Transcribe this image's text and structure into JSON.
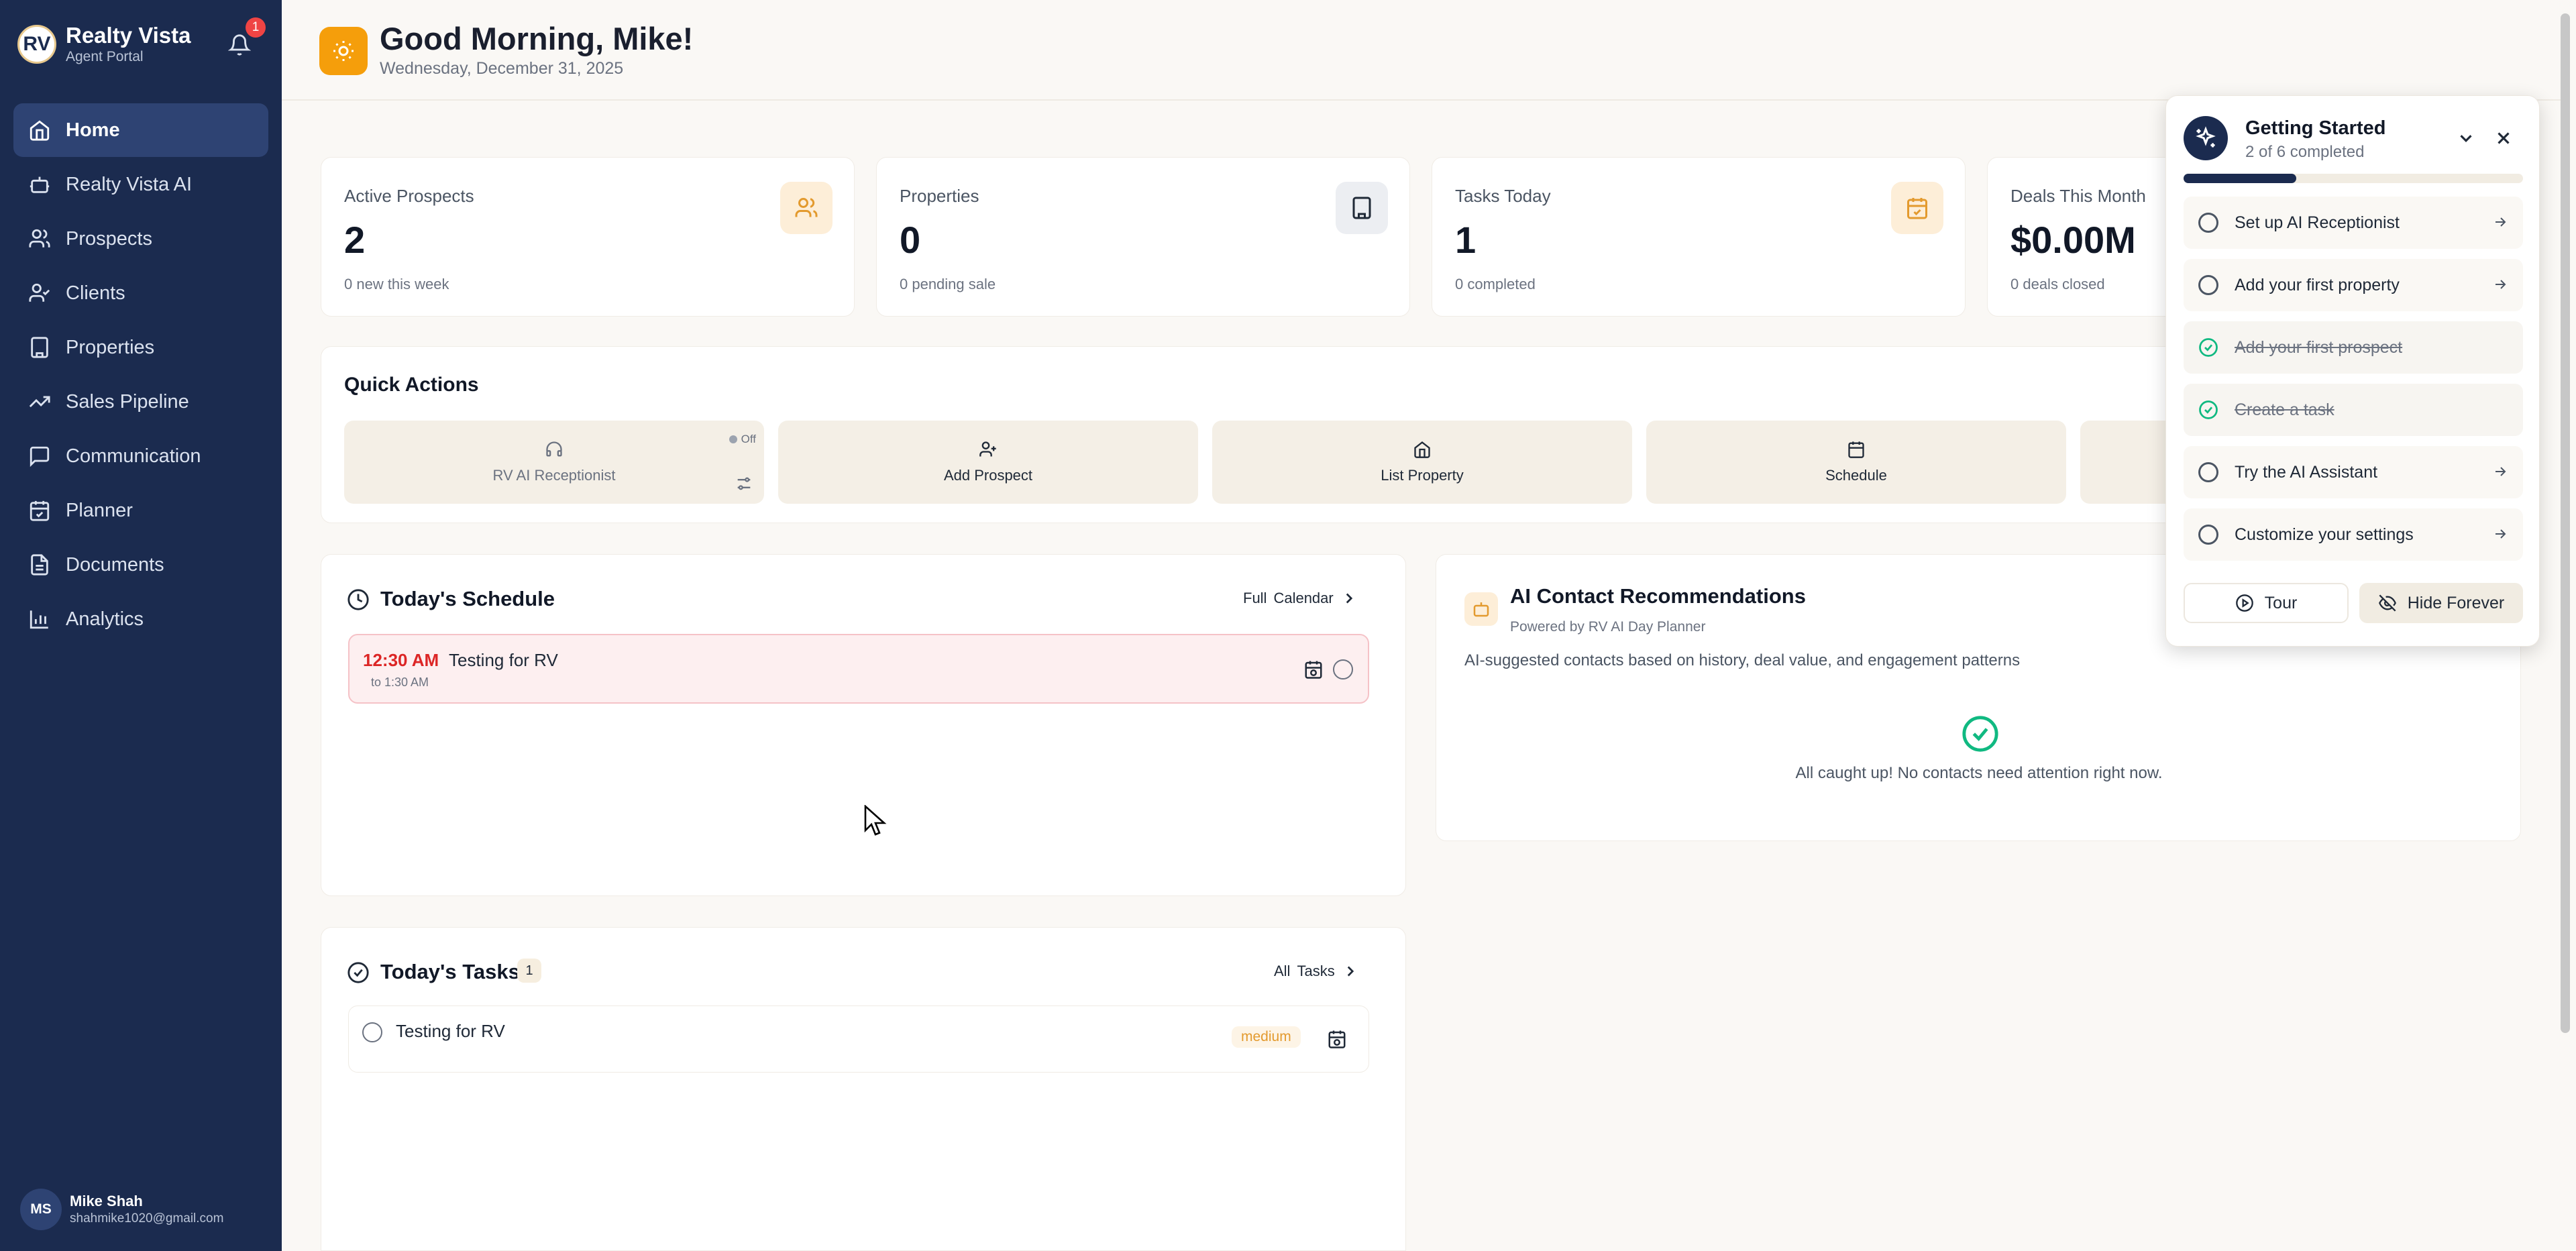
{
  "app": {
    "name": "Realty Vista",
    "subtitle": "Agent Portal",
    "logo_text": "RV",
    "notification_count": "1"
  },
  "nav": [
    {
      "label": "Home",
      "icon": "home-icon"
    },
    {
      "label": "Realty Vista AI",
      "icon": "bot-icon"
    },
    {
      "label": "Prospects",
      "icon": "users-icon"
    },
    {
      "label": "Clients",
      "icon": "user-check-icon"
    },
    {
      "label": "Properties",
      "icon": "building-icon"
    },
    {
      "label": "Sales Pipeline",
      "icon": "trending-up-icon"
    },
    {
      "label": "Communication",
      "icon": "message-icon"
    },
    {
      "label": "Planner",
      "icon": "calendar-check-icon"
    },
    {
      "label": "Documents",
      "icon": "file-icon"
    },
    {
      "label": "Analytics",
      "icon": "bar-chart-icon"
    }
  ],
  "user": {
    "initials": "MS",
    "name": "Mike Shah",
    "email": "shahmike1020@gmail.com"
  },
  "header": {
    "greeting": "Good Morning, Mike!",
    "date": "Wednesday, December 31, 2025"
  },
  "stats": [
    {
      "label": "Active Prospects",
      "value": "2",
      "sub": "0 new this week",
      "icon": "users-icon"
    },
    {
      "label": "Properties",
      "value": "0",
      "sub": "0 pending sale",
      "icon": "building-icon"
    },
    {
      "label": "Tasks Today",
      "value": "1",
      "sub": "0 completed",
      "icon": "calendar-check-icon"
    },
    {
      "label": "Deals This Month",
      "value": "$0.00M",
      "sub": "0 deals closed",
      "icon": "dollar-icon"
    }
  ],
  "quick_actions": {
    "title": "Quick Actions",
    "receptionist": {
      "label": "RV AI Receptionist",
      "status": "Off"
    },
    "buttons": [
      {
        "label": "Add Prospect"
      },
      {
        "label": "List Property"
      },
      {
        "label": "Schedule"
      }
    ]
  },
  "schedule": {
    "title": "Today's Schedule",
    "link_a": "Full",
    "link_b": "Calendar",
    "event": {
      "time": "12:30 AM",
      "end": "to 1:30 AM",
      "title": "Testing for RV"
    }
  },
  "recommendations": {
    "title": "AI Contact Recommendations",
    "powered": "Powered by RV AI Day Planner",
    "desc": "AI-suggested contacts based on history, deal value, and engagement patterns",
    "empty": "All caught up! No contacts need attention right now."
  },
  "tasks": {
    "title": "Today's Tasks",
    "count": "1",
    "link_a": "All",
    "link_b": "Tasks",
    "items": [
      {
        "title": "Testing for RV",
        "priority": "medium"
      }
    ]
  },
  "getting_started": {
    "title": "Getting Started",
    "progress_text": "2 of 6 completed",
    "progress": 0.333,
    "items": [
      {
        "label": "Set up AI Receptionist",
        "done": false
      },
      {
        "label": "Add your first property",
        "done": false
      },
      {
        "label": "Add your first prospect",
        "done": true
      },
      {
        "label": "Create a task",
        "done": true
      },
      {
        "label": "Try the AI Assistant",
        "done": false
      },
      {
        "label": "Customize your settings",
        "done": false
      }
    ],
    "tour_label": "Tour",
    "hide_label": "Hide Forever"
  },
  "colors": {
    "sidebar": "#1b2b4f",
    "accent": "#f59e0b",
    "success": "#10b981",
    "danger": "#ef4444"
  }
}
